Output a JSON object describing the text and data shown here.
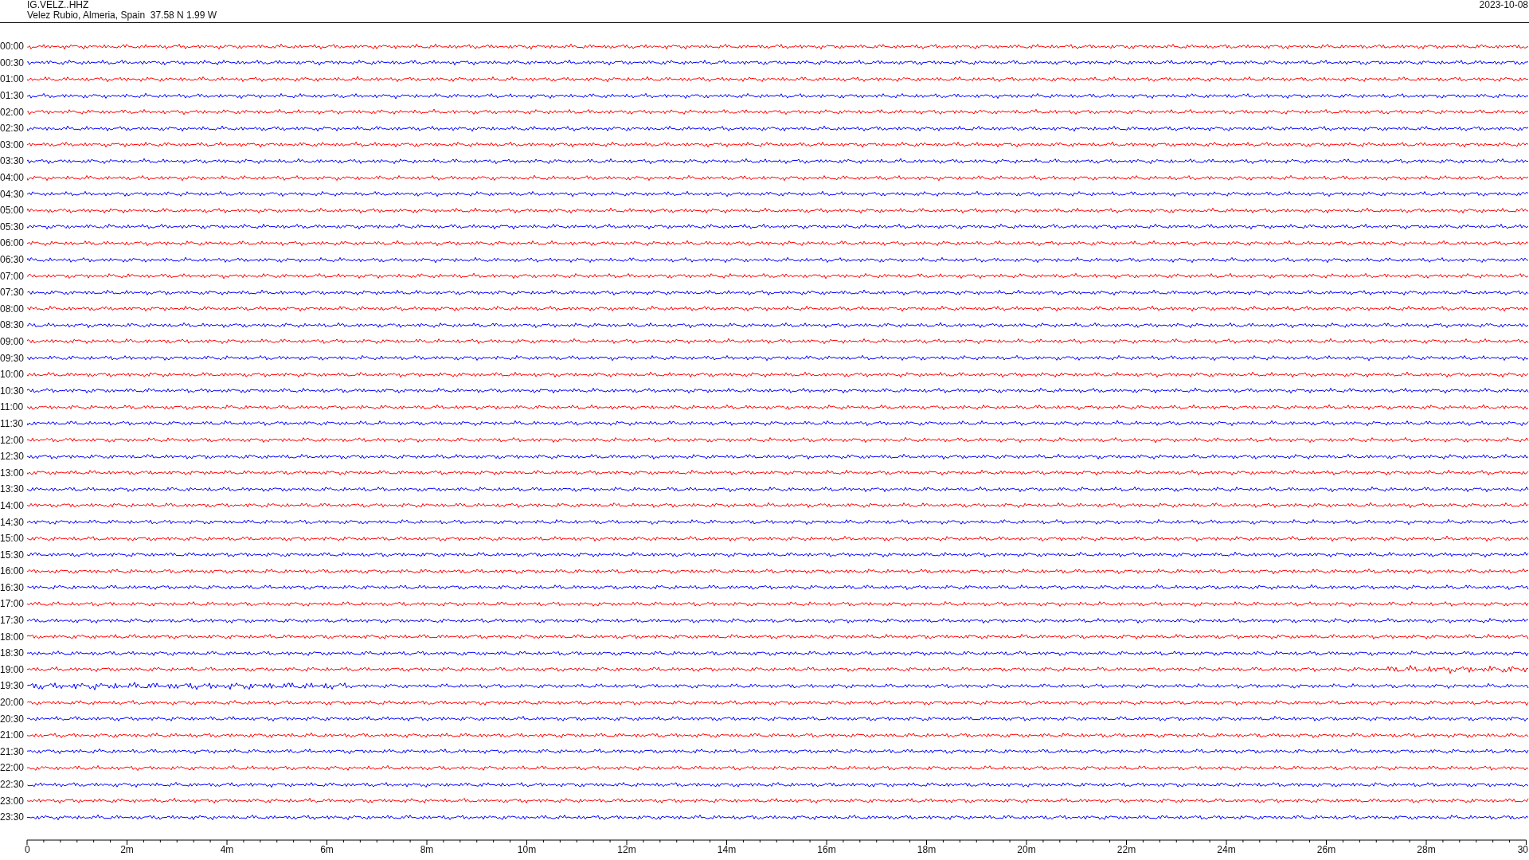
{
  "header": {
    "station": "IG.VELZ..HHZ",
    "location": "Velez Rubio, Almeria, Spain  37.58 N 1.99 W",
    "date": "2023-10-08"
  },
  "rows": [
    {
      "label": "00:00",
      "color": "#ff0000"
    },
    {
      "label": "00:30",
      "color": "#0000ff"
    },
    {
      "label": "01:00",
      "color": "#ff0000"
    },
    {
      "label": "01:30",
      "color": "#0000ff"
    },
    {
      "label": "02:00",
      "color": "#ff0000"
    },
    {
      "label": "02:30",
      "color": "#0000ff"
    },
    {
      "label": "03:00",
      "color": "#ff0000"
    },
    {
      "label": "03:30",
      "color": "#0000ff"
    },
    {
      "label": "04:00",
      "color": "#ff0000"
    },
    {
      "label": "04:30",
      "color": "#0000ff"
    },
    {
      "label": "05:00",
      "color": "#ff0000"
    },
    {
      "label": "05:30",
      "color": "#0000ff"
    },
    {
      "label": "06:00",
      "color": "#ff0000"
    },
    {
      "label": "06:30",
      "color": "#0000ff"
    },
    {
      "label": "07:00",
      "color": "#ff0000"
    },
    {
      "label": "07:30",
      "color": "#0000ff"
    },
    {
      "label": "08:00",
      "color": "#ff0000"
    },
    {
      "label": "08:30",
      "color": "#0000ff"
    },
    {
      "label": "09:00",
      "color": "#ff0000"
    },
    {
      "label": "09:30",
      "color": "#0000ff"
    },
    {
      "label": "10:00",
      "color": "#ff0000"
    },
    {
      "label": "10:30",
      "color": "#0000ff"
    },
    {
      "label": "11:00",
      "color": "#ff0000"
    },
    {
      "label": "11:30",
      "color": "#0000ff"
    },
    {
      "label": "12:00",
      "color": "#ff0000"
    },
    {
      "label": "12:30",
      "color": "#0000ff"
    },
    {
      "label": "13:00",
      "color": "#ff0000"
    },
    {
      "label": "13:30",
      "color": "#0000ff"
    },
    {
      "label": "14:00",
      "color": "#ff0000"
    },
    {
      "label": "14:30",
      "color": "#0000ff"
    },
    {
      "label": "15:00",
      "color": "#ff0000"
    },
    {
      "label": "15:30",
      "color": "#0000ff"
    },
    {
      "label": "16:00",
      "color": "#ff0000"
    },
    {
      "label": "16:30",
      "color": "#0000ff"
    },
    {
      "label": "17:00",
      "color": "#ff0000"
    },
    {
      "label": "17:30",
      "color": "#0000ff"
    },
    {
      "label": "18:00",
      "color": "#ff0000"
    },
    {
      "label": "18:30",
      "color": "#0000ff"
    },
    {
      "label": "19:00",
      "color": "#ff0000"
    },
    {
      "label": "19:30",
      "color": "#0000ff"
    },
    {
      "label": "20:00",
      "color": "#ff0000"
    },
    {
      "label": "20:30",
      "color": "#0000ff"
    },
    {
      "label": "21:00",
      "color": "#ff0000"
    },
    {
      "label": "21:30",
      "color": "#0000ff"
    },
    {
      "label": "22:00",
      "color": "#ff0000"
    },
    {
      "label": "22:30",
      "color": "#0000ff"
    },
    {
      "label": "23:00",
      "color": "#ff0000"
    },
    {
      "label": "23:30",
      "color": "#0000ff"
    }
  ],
  "time_axis": {
    "labels": [
      "0",
      "2m",
      "4m",
      "6m",
      "8m",
      "10m",
      "12m",
      "14m",
      "16m",
      "18m",
      "20m",
      "22m",
      "24m",
      "26m",
      "28m",
      "30"
    ]
  }
}
